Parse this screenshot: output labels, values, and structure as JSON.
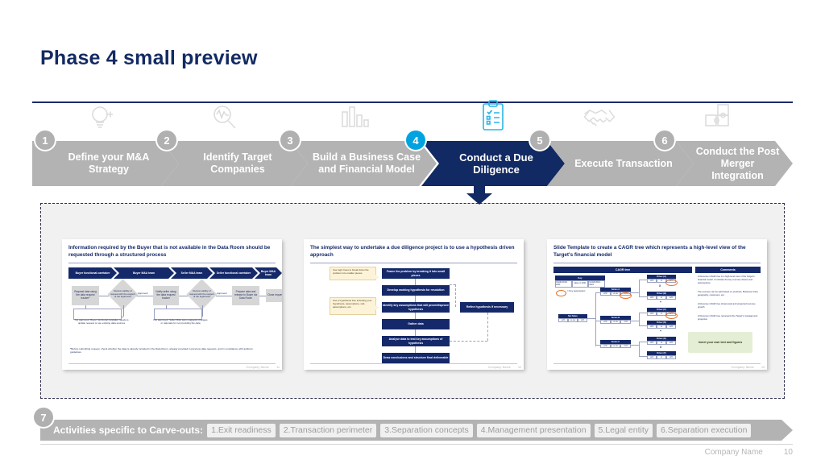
{
  "slide": {
    "title": "Phase 4 small preview",
    "footer": {
      "company": "Company Name",
      "page": "10"
    }
  },
  "process": {
    "steps": [
      {
        "num": "1",
        "label": "Define your M&A Strategy",
        "icon": "lightbulb-icon",
        "active": false
      },
      {
        "num": "2",
        "label": "Identify Target Companies",
        "icon": "search-magnifier-icon",
        "active": false
      },
      {
        "num": "3",
        "label": "Build a Business Case and Financial Model",
        "icon": "bar-chart-icon",
        "active": false
      },
      {
        "num": "4",
        "label": "Conduct a Due Diligence",
        "icon": "clipboard-checklist-icon",
        "active": true
      },
      {
        "num": "5",
        "label": "Execute Transaction",
        "icon": "handshake-icon",
        "active": false
      },
      {
        "num": "6",
        "label": "Conduct the Post Merger Integration",
        "icon": "puzzle-icon",
        "active": false
      }
    ],
    "active_indicator": "down-arrow-icon",
    "colors": {
      "inactive": "#b3b3b3",
      "active": "#122a63",
      "active_badge": "#00a3e0",
      "badge": "#b0b0b0"
    }
  },
  "previews": {
    "card1": {
      "title": "Information required by the Buyer that is not available in the Data Room should be requested through a structured process",
      "swimlanes": [
        "Buyer functional caretaker",
        "Buyer M&A team",
        "Seller M&A team",
        "Seller functional caretaker",
        "Buyer M&A team"
      ],
      "flow": [
        {
          "type": "box",
          "text": "Request data using the data request tracker*"
        },
        {
          "type": "decision",
          "text": "Review validity of request with the support of the legal team"
        },
        {
          "type": "connector",
          "text": "Approved"
        },
        {
          "type": "box",
          "text": "Notify seller using the data request tracker"
        },
        {
          "type": "decision",
          "text": "Review validity of request with the support of the legal team"
        },
        {
          "type": "connector",
          "text": "Approved"
        },
        {
          "type": "box",
          "text": "Prepare data and release to Buyer via Data Room"
        },
        {
          "type": "box",
          "text": "Close request"
        }
      ],
      "rejections": [
        "Not approved: Buyer functional caretaker needs to update request or use existing data sources",
        "Not approved: Seller M&A team suggests changes or rationale for not providing the data"
      ],
      "footnote": "*Before submitting request, check whether the data is already included in the Data Room, already provided in previous data requests, and in compliance with antitrust guidelines",
      "footer": {
        "company": "Company Name",
        "page": "11"
      }
    },
    "card2": {
      "title": "The simplest way to undertake a due diligence project is to use a hypothesis driven approach",
      "steps": [
        "Frame the problem by breaking it into small pieces",
        "Develop working hypothesis for resolution",
        "Identify key assumptions that will prove/disprove hypothesis",
        "Gather data",
        "Analyse data to test key assumptions of hypothesis",
        "Draw conclusions and structure final deliverable"
      ],
      "side_step": "Refine hypothesis if necessary",
      "callouts": [
        "Use logic trees to break down the problem into smaller pieces",
        "Use a hypothesis tree including your hypothesis, assumptions, sub-assumptions, etc."
      ],
      "footer": {
        "company": "Company Name",
        "page": "12"
      }
    },
    "card3": {
      "title": "Slide Template to create a CAGR tree which represents a high-level view of the Target's financial model",
      "headers": [
        "CAGR tree",
        "Comments"
      ],
      "key_header": "Key",
      "key_cells": [
        "CAGR 2019-2021",
        "Value in 2021",
        "CAGR 2021-2024"
      ],
      "key_note": "= Key assumption",
      "root": {
        "label": "Net Sales",
        "cells": [
          "xx%",
          "xx.xxx",
          "xx%"
        ]
      },
      "branches": [
        {
          "label": "Series A",
          "cells": [
            "xx%",
            "xx.xxx",
            "xx%"
          ]
        },
        {
          "label": "Series B",
          "cells": [
            "xx%",
            "xx.xxx",
            "xx%"
          ]
        },
        {
          "label": "Series C",
          "cells": [
            "xx%",
            "xx.xxx",
            "xx%"
          ]
        }
      ],
      "drivers": [
        {
          "label": "Driver (A)",
          "cells": [
            "xx%",
            "xx",
            "xx%"
          ]
        },
        {
          "label": "Driver (B)",
          "cells": [
            "xx%",
            "xx",
            "xx%"
          ]
        },
        {
          "label": "Driver (C)",
          "cells": [
            "xx%",
            "xx",
            "xx%"
          ]
        },
        {
          "label": "Driver (D)",
          "cells": [
            "xx%",
            "xx",
            "xx%"
          ]
        },
        {
          "label": "Driver (E)",
          "cells": [
            "xx%",
            "xx",
            "xx%"
          ]
        },
        {
          "label": "Driver (F)",
          "cells": [
            "xx%",
            "xx",
            "xx%"
          ]
        }
      ],
      "operators": [
        "X",
        "+",
        "+",
        "X"
      ],
      "comments": [
        "A Revenue CAGR tree is a high-level view of the Target's financial model. It includes the key revenue drivers and assumptions",
        "The revenue can be split based on products, Business Units, geography, customers, etc.",
        "A Revenue CAGR tree shows past and projected revenue growth",
        "A Revenue CAGR tree represents the Target's management projection"
      ],
      "green_callout": "Insert your own text and figures",
      "footer": {
        "company": "Company Name",
        "page": "13"
      }
    }
  },
  "carveouts": {
    "num": "7",
    "label": "Activities specific to Carve-outs:",
    "tags": [
      "1.Exit readiness",
      "2.Transaction perimeter",
      "3.Separation concepts",
      "4.Management presentation",
      "5.Legal entity",
      "6.Separation execution"
    ]
  }
}
